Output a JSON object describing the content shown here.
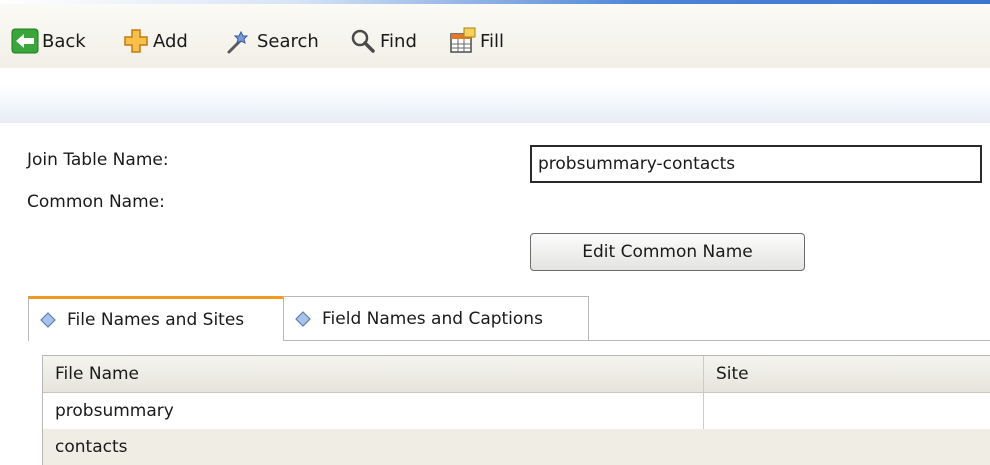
{
  "toolbar": {
    "back_label": "Back",
    "add_label": "Add",
    "search_label": "Search",
    "find_label": "Find",
    "fill_label": "Fill"
  },
  "form": {
    "join_table_label": "Join Table Name:",
    "common_name_label": "Common Name:",
    "join_table_value": "probsummary-contacts",
    "edit_common_name_label": "Edit Common Name"
  },
  "tabs": [
    {
      "label": "File Names and Sites",
      "active": true
    },
    {
      "label": "Field Names and Captions",
      "active": false
    }
  ],
  "table": {
    "columns": [
      "File Name",
      "Site"
    ],
    "rows": [
      [
        "probsummary",
        ""
      ],
      [
        "contacts",
        ""
      ]
    ]
  },
  "colors": {
    "active_tab_accent": "#f29a22",
    "back_icon_green": "#3aa53a",
    "add_icon_orange": "#f2a12e"
  }
}
